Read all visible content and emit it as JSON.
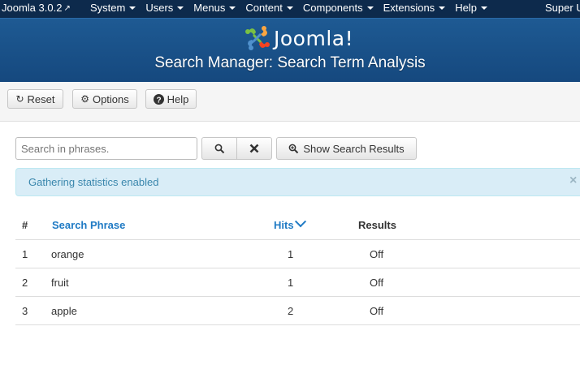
{
  "navbar": {
    "brand": "Joomla 3.0.2",
    "menu": [
      "System",
      "Users",
      "Menus",
      "Content",
      "Components",
      "Extensions",
      "Help"
    ],
    "user": "Super U"
  },
  "header": {
    "logo_text": "Joomla!",
    "title": "Search Manager: Search Term Analysis"
  },
  "toolbar": {
    "reset_label": "Reset",
    "options_label": "Options",
    "help_label": "Help"
  },
  "filter": {
    "search_placeholder": "Search in phrases.",
    "show_results_label": "Show Search Results"
  },
  "alert": {
    "message": "Gathering statistics enabled",
    "close": "×"
  },
  "table": {
    "headers": {
      "num": "#",
      "phrase": "Search Phrase",
      "hits": "Hits",
      "results": "Results"
    },
    "rows": [
      {
        "num": "1",
        "phrase": "orange",
        "hits": "1",
        "results": "Off"
      },
      {
        "num": "2",
        "phrase": "fruit",
        "hits": "1",
        "results": "Off"
      },
      {
        "num": "3",
        "phrase": "apple",
        "hits": "2",
        "results": "Off"
      }
    ]
  },
  "colors": {
    "navbar": "#0d2a4c",
    "header": "#1b5289",
    "link": "#1f7ac4",
    "alert_bg": "#d9edf7",
    "alert_text": "#3a87ad"
  }
}
